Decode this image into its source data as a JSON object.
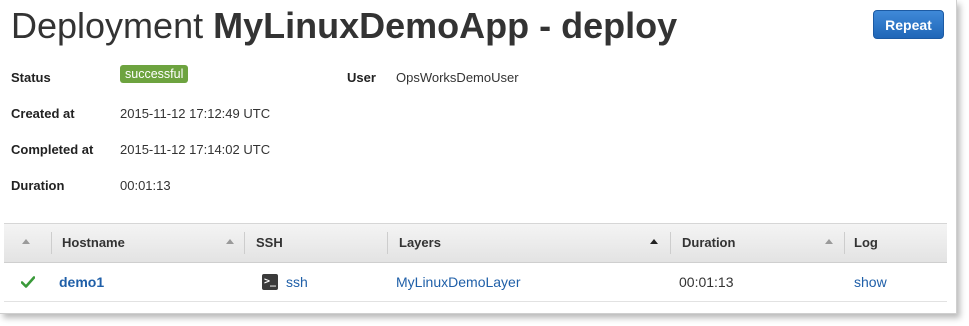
{
  "header": {
    "title_prefix": "Deployment",
    "title_app": "MyLinuxDemoApp - deploy",
    "repeat_label": "Repeat"
  },
  "details": {
    "status_label": "Status",
    "status_value": "successful",
    "status_color": "#6da33f",
    "user_label": "User",
    "user_value": "OpsWorksDemoUser",
    "created_label": "Created at",
    "created_value": "2015-11-12 17:12:49 UTC",
    "completed_label": "Completed at",
    "completed_value": "2015-11-12 17:14:02 UTC",
    "duration_label": "Duration",
    "duration_value": "00:01:13"
  },
  "table": {
    "columns": {
      "hostname": "Hostname",
      "ssh": "SSH",
      "layers": "Layers",
      "duration": "Duration",
      "log": "Log"
    },
    "rows": [
      {
        "status_icon": "check-icon",
        "hostname": "demo1",
        "ssh_icon": "terminal-icon",
        "ssh": "ssh",
        "layer": "MyLinuxDemoLayer",
        "duration": "00:01:13",
        "log": "show"
      }
    ]
  },
  "colors": {
    "accent_button": "#2a74c8",
    "link": "#1f5fa8",
    "success_check": "#3a9a3a"
  }
}
